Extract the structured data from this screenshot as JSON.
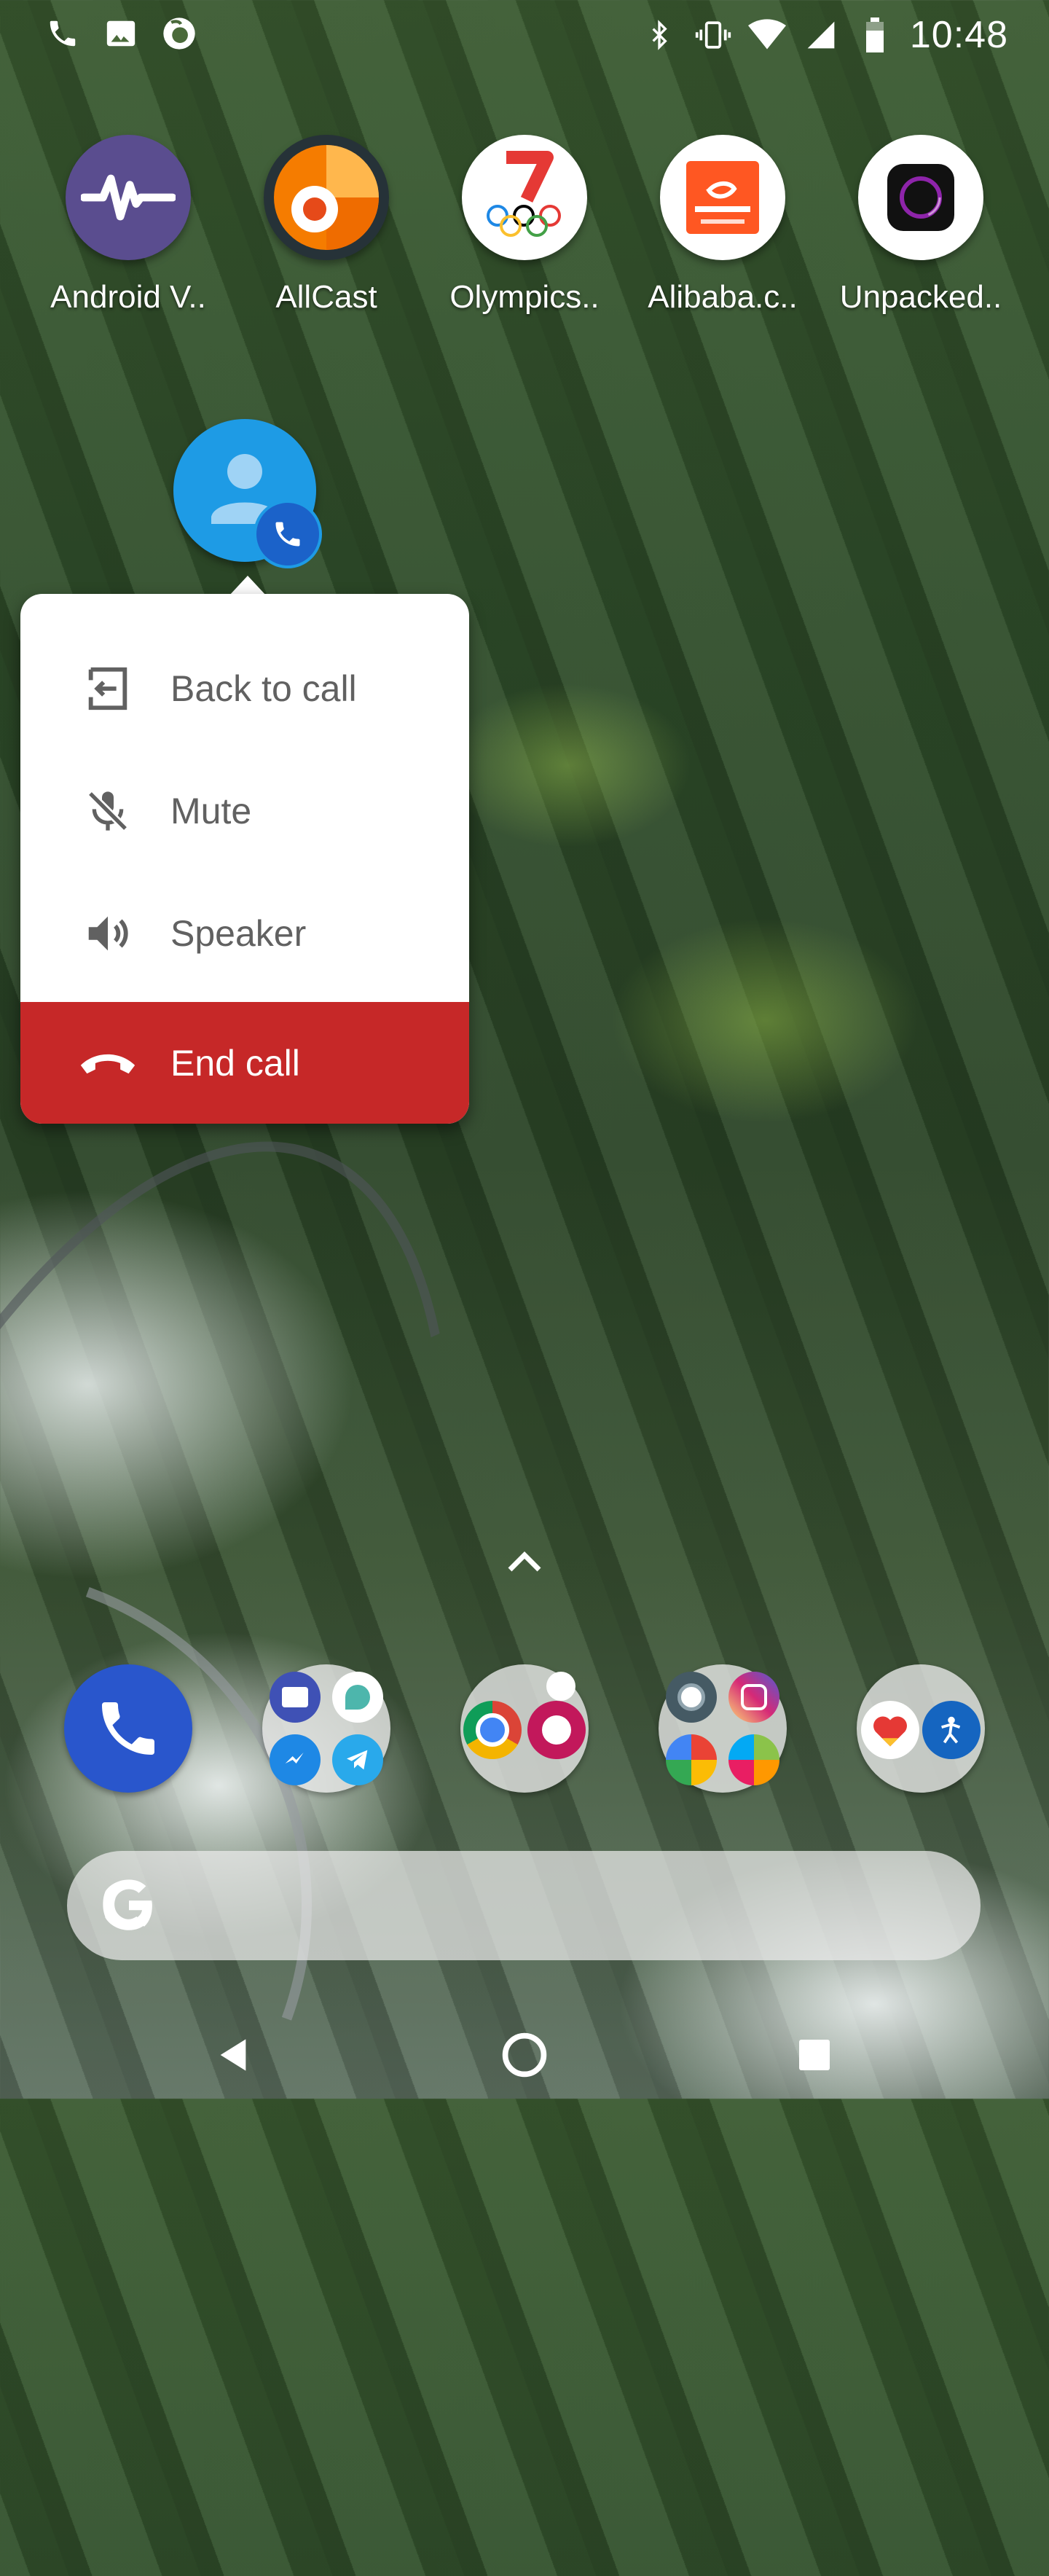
{
  "status_bar": {
    "time": "10:48",
    "left_icons": [
      "phone-icon",
      "image-icon",
      "firefox-icon"
    ],
    "right_icons": [
      "bluetooth-icon",
      "vibrate-icon",
      "wifi-icon",
      "signal-icon",
      "battery-icon"
    ]
  },
  "apps": [
    {
      "label": "Android V..",
      "icon": "android-vitals-icon",
      "color": "#5a4d8f"
    },
    {
      "label": "AllCast",
      "icon": "allcast-icon",
      "color": "#ef6c00"
    },
    {
      "label": "Olympics..",
      "icon": "olympics-icon",
      "color": "#e53935"
    },
    {
      "label": "Alibaba.c..",
      "icon": "alibaba-icon",
      "color": "#ff5722"
    },
    {
      "label": "Unpacked..",
      "icon": "unpacked-icon",
      "color": "#111111"
    }
  ],
  "shortcut_menu": {
    "items": [
      {
        "label": "Back to call",
        "icon": "back-to-call-icon"
      },
      {
        "label": "Mute",
        "icon": "mic-off-icon"
      },
      {
        "label": "Speaker",
        "icon": "speaker-icon"
      },
      {
        "label": "End call",
        "icon": "end-call-icon"
      }
    ],
    "end_call_color": "#c62828"
  },
  "dock": {
    "items": [
      "phone-app",
      "messaging-folder",
      "browser-folder",
      "photos-folder",
      "health-folder"
    ]
  },
  "search": {
    "icon": "google-g-icon"
  },
  "navigation": {
    "buttons": [
      "back-button",
      "home-button",
      "recents-button"
    ]
  }
}
